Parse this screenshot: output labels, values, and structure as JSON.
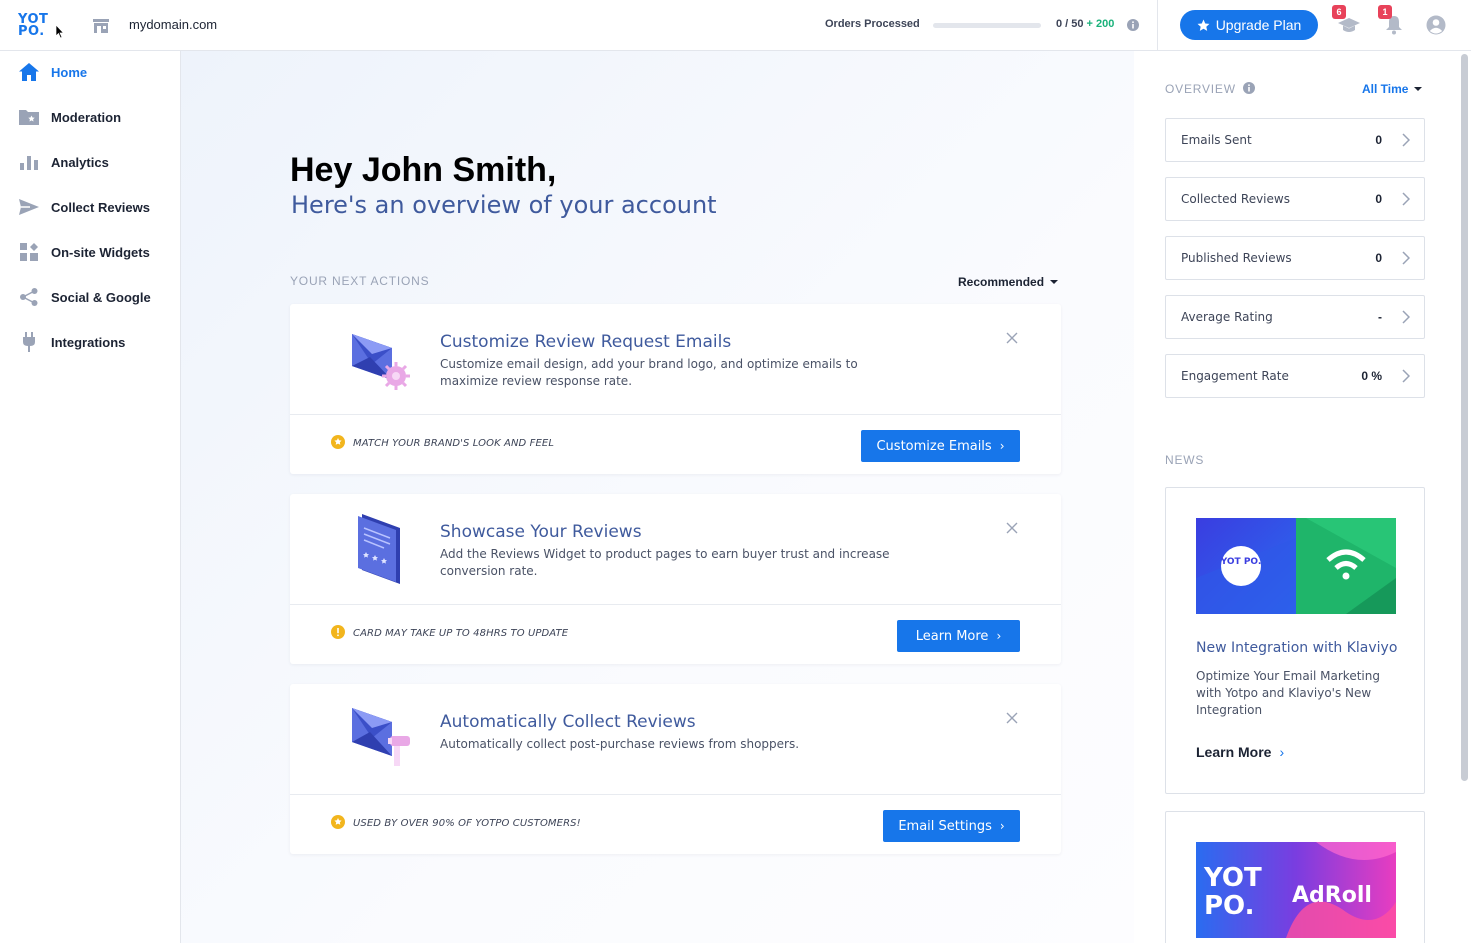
{
  "header": {
    "logo_text": "YOTPO.",
    "domain": "mydomain.com",
    "orders_label": "Orders Processed",
    "orders_progress": 0,
    "orders_count": "0 / 50",
    "orders_bonus": "+ 200",
    "upgrade_label": "Upgrade Plan",
    "academy_badge": "6",
    "notifications_badge": "1"
  },
  "sidebar": {
    "items": [
      {
        "label": "Home",
        "icon": "home-icon",
        "active": true
      },
      {
        "label": "Moderation",
        "icon": "moderation-folder-icon"
      },
      {
        "label": "Analytics",
        "icon": "bar-chart-icon"
      },
      {
        "label": "Collect Reviews",
        "icon": "send-icon"
      },
      {
        "label": "On-site Widgets",
        "icon": "widgets-icon"
      },
      {
        "label": "Social & Google",
        "icon": "share-icon"
      },
      {
        "label": "Integrations",
        "icon": "plug-icon"
      }
    ]
  },
  "main": {
    "greeting": "Hey John Smith,",
    "subtitle": "Here's an overview of your account",
    "next_actions_label": "YOUR NEXT ACTIONS",
    "sort_label": "Recommended",
    "cards": [
      {
        "title": "Customize Review Request Emails",
        "description": "Customize email design, add your brand logo, and optimize emails to maximize review response rate.",
        "footer": "MATCH YOUR BRAND'S LOOK AND FEEL",
        "footer_icon": "star-badge-icon",
        "button": "Customize Emails"
      },
      {
        "title": "Showcase Your Reviews",
        "description": "Add the Reviews Widget to product pages to earn buyer trust and increase conversion rate.",
        "footer": "CARD MAY TAKE UP TO 48HRS TO UPDATE",
        "footer_icon": "alert-icon",
        "button": "Learn More"
      },
      {
        "title": "Automatically Collect Reviews",
        "description": "Automatically collect post-purchase reviews from shoppers.",
        "footer": "USED BY OVER 90% OF YOTPO CUSTOMERS!",
        "footer_icon": "star-badge-icon",
        "button": "Email Settings"
      }
    ]
  },
  "overview": {
    "title": "OVERVIEW",
    "range": "All Time",
    "stats": [
      {
        "label": "Emails Sent",
        "value": "0"
      },
      {
        "label": "Collected Reviews",
        "value": "0"
      },
      {
        "label": "Published Reviews",
        "value": "0"
      },
      {
        "label": "Average Rating",
        "value": "-"
      },
      {
        "label": "Engagement Rate",
        "value": "0 %"
      }
    ]
  },
  "news": {
    "title": "NEWS",
    "items": [
      {
        "headline": "New Integration with Klaviyo",
        "description": "Optimize Your Email Marketing with Yotpo and Klaviyo's New Integration",
        "link": "Learn More",
        "image_logo": "YOT PO.",
        "accent": "#1fb56a"
      },
      {
        "image_logo": "YOT PO.",
        "partner": "AdRoll"
      }
    ]
  },
  "colors": {
    "accent": "#1776ea",
    "heading_blue": "#3f5a9d",
    "badge_red": "#e8425a",
    "bonus_green": "#19b17a",
    "star_yellow": "#f2b51d"
  }
}
